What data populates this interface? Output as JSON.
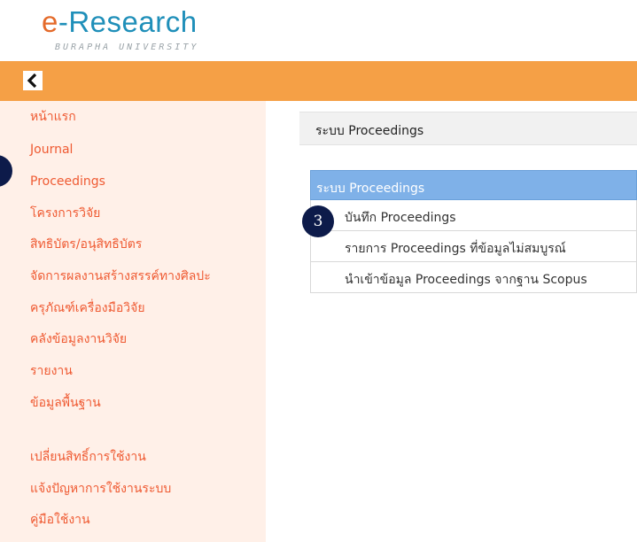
{
  "logo": {
    "prefix": "e",
    "main": "-Research",
    "subtitle": "BURAPHA UNIVERSITY"
  },
  "colors": {
    "brand_orange": "#f5a046",
    "sidebar_bg": "#fff0e8",
    "link_red": "#ef5a32",
    "panel_blue": "#7fb1e8",
    "marker_navy": "#0d1b4a"
  },
  "toolbar": {
    "collapse_icon": "chevron-left-icon"
  },
  "sidebar": {
    "items": [
      {
        "label": "หน้าแรก"
      },
      {
        "label": "Journal"
      },
      {
        "label": "Proceedings"
      },
      {
        "label": "โครงการวิจัย"
      },
      {
        "label": "สิทธิบัตร/อนุสิทธิบัตร"
      },
      {
        "label": "จัดการผลงานสร้างสรรค์ทางศิลปะ"
      },
      {
        "label": "ครุภัณฑ์เครื่องมือวิจัย"
      },
      {
        "label": "คลังข้อมูลงานวิจัย"
      },
      {
        "label": "รายงาน"
      },
      {
        "label": "ข้อมูลพื้นฐาน"
      },
      {
        "label": "เปลี่ยนสิทธิ์การใช้งาน"
      },
      {
        "label": "แจ้งปัญหาการใช้งานระบบ"
      },
      {
        "label": "คู่มือใช้งาน"
      }
    ]
  },
  "main": {
    "header_title": "ระบบ Proceedings",
    "panel": {
      "title": "ระบบ Proceedings",
      "items": [
        {
          "label": "บันทึก Proceedings"
        },
        {
          "label": "รายการ Proceedings ที่ข้อมูลไม่สมบูรณ์"
        },
        {
          "label": "นำเข้าข้อมูล Proceedings จากฐาน Scopus"
        }
      ]
    }
  },
  "annotations": {
    "step_marker": "3"
  }
}
